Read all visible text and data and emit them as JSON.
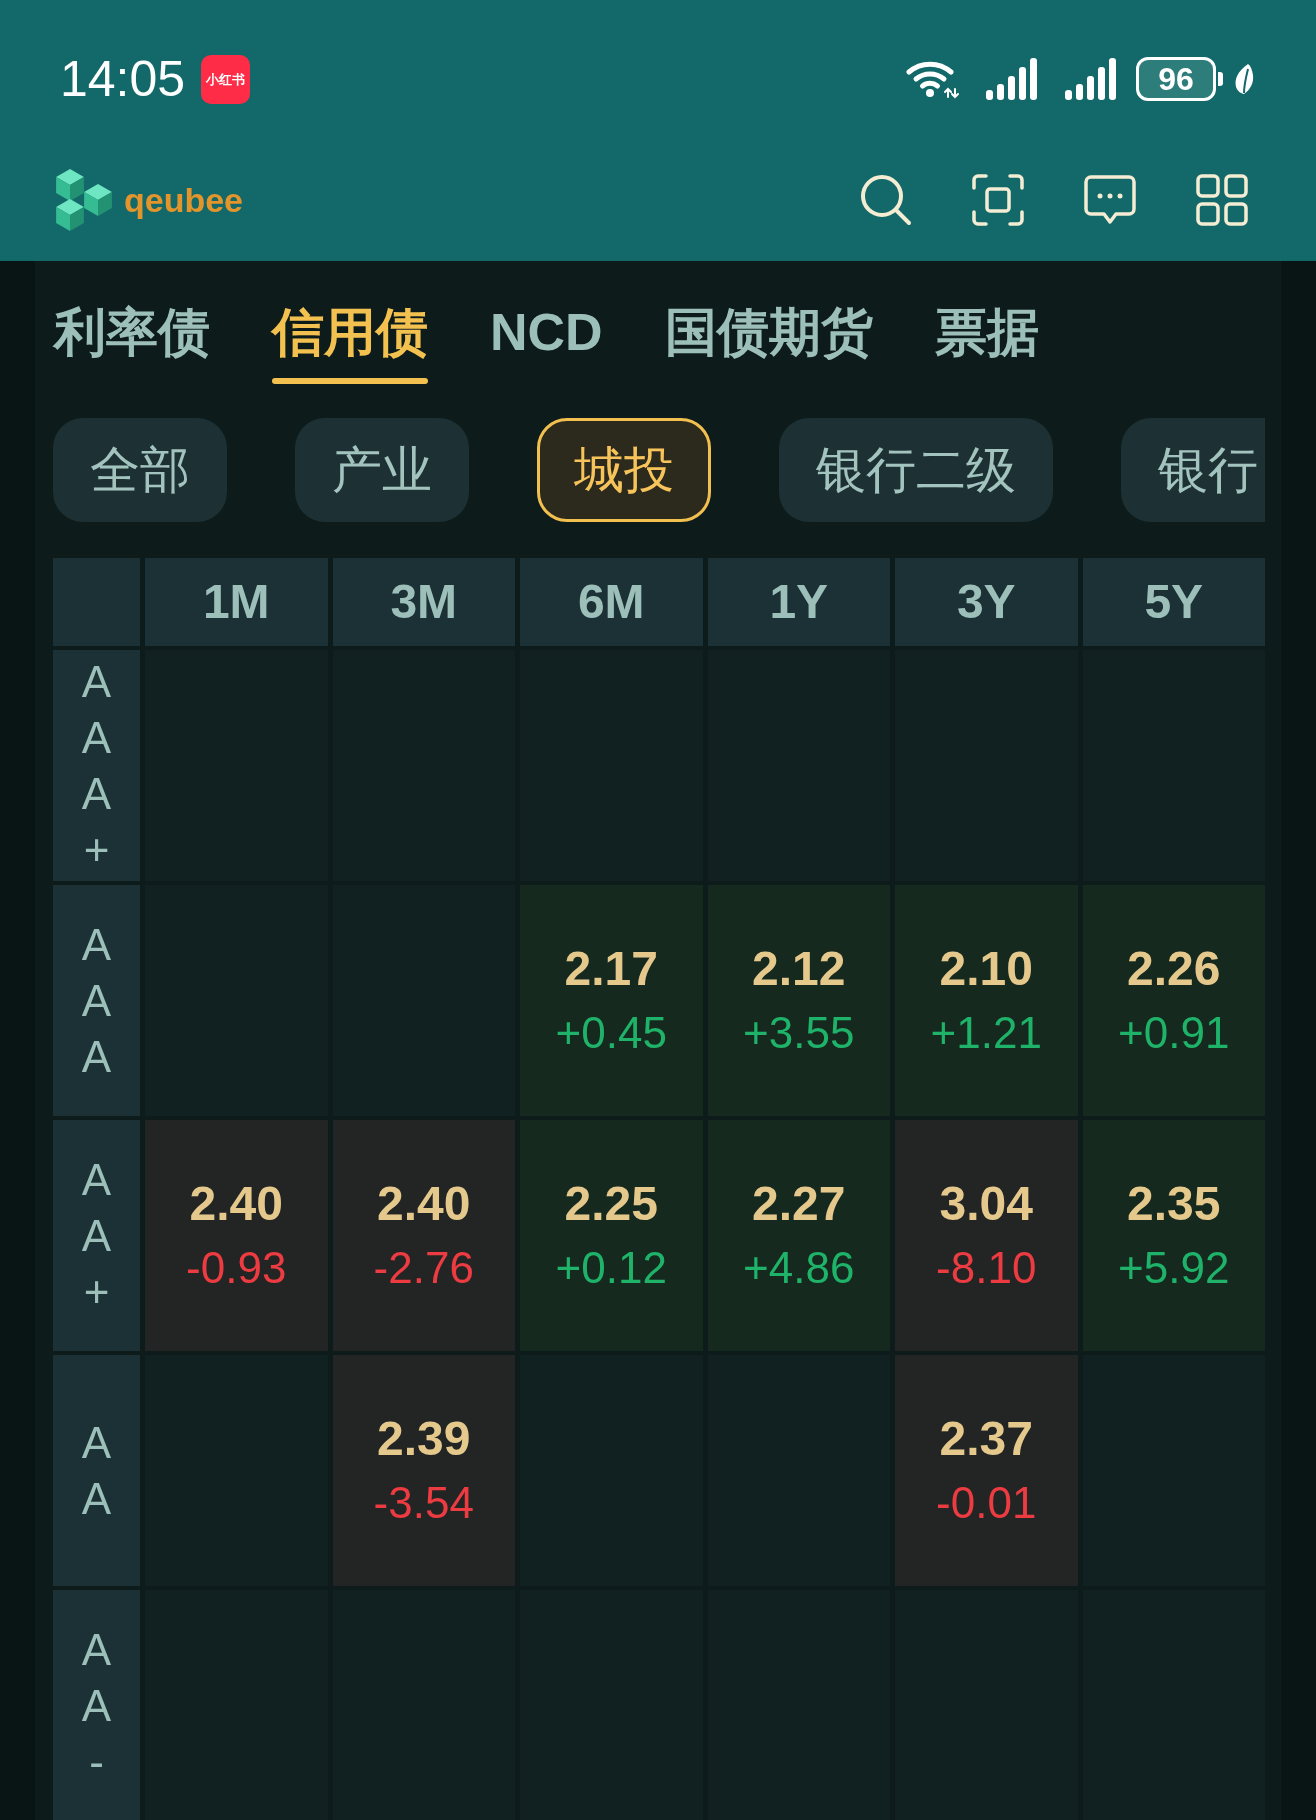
{
  "status_bar": {
    "time": "14:05",
    "notification_app": "小红书",
    "battery": "96"
  },
  "app_bar": {
    "logo_text": "qeubee"
  },
  "tabs": [
    {
      "label": "利率债",
      "selected": false
    },
    {
      "label": "信用债",
      "selected": true
    },
    {
      "label": "NCD",
      "selected": false
    },
    {
      "label": "国债期货",
      "selected": false
    },
    {
      "label": "票据",
      "selected": false
    }
  ],
  "filters": [
    {
      "label": "全部",
      "selected": false
    },
    {
      "label": "产业",
      "selected": false
    },
    {
      "label": "城投",
      "selected": true
    },
    {
      "label": "银行二级",
      "selected": false
    },
    {
      "label": "银行",
      "selected": false
    }
  ],
  "table": {
    "columns": [
      "1M",
      "3M",
      "6M",
      "1Y",
      "3Y",
      "5Y"
    ],
    "rows": [
      {
        "rating": "AAA+",
        "cells": [
          null,
          null,
          null,
          null,
          null,
          null
        ]
      },
      {
        "rating": "AAA",
        "cells": [
          null,
          null,
          {
            "value": "2.17",
            "change": "+0.45",
            "rising": true
          },
          {
            "value": "2.12",
            "change": "+3.55",
            "rising": true
          },
          {
            "value": "2.10",
            "change": "+1.21",
            "rising": true
          },
          {
            "value": "2.26",
            "change": "+0.91",
            "rising": true
          }
        ]
      },
      {
        "rating": "AA+",
        "cells": [
          {
            "value": "2.40",
            "change": "-0.93",
            "rising": false
          },
          {
            "value": "2.40",
            "change": "-2.76",
            "rising": false
          },
          {
            "value": "2.25",
            "change": "+0.12",
            "rising": true
          },
          {
            "value": "2.27",
            "change": "+4.86",
            "rising": true
          },
          {
            "value": "3.04",
            "change": "-8.10",
            "rising": false
          },
          {
            "value": "2.35",
            "change": "+5.92",
            "rising": true
          }
        ]
      },
      {
        "rating": "AA",
        "cells": [
          null,
          {
            "value": "2.39",
            "change": "-3.54",
            "rising": false
          },
          null,
          null,
          {
            "value": "2.37",
            "change": "-0.01",
            "rising": false
          },
          null
        ]
      },
      {
        "rating": "AA-",
        "cells": [
          null,
          null,
          null,
          null,
          null,
          null
        ]
      }
    ]
  }
}
